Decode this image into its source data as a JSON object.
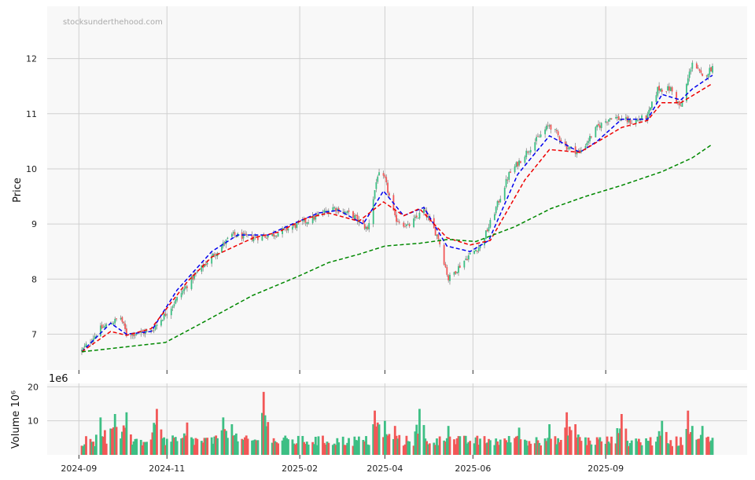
{
  "chart_data": {
    "type": "candlestick",
    "watermark": "stocksunderthehood.com",
    "colors": {
      "up": "#3dbf84",
      "down": "#f25757",
      "ma_fast": "#0000ee",
      "ma_mid": "#ee0000",
      "ma_slow": "#008800",
      "grid": "#d0d0d0",
      "panel_bg": "#f8f8f8"
    },
    "x_axis": {
      "ticks": [
        "2024-09",
        "2024-11",
        "2025-02",
        "2025-04",
        "2025-06",
        "2025-09"
      ]
    },
    "price_panel": {
      "ylabel": "Price",
      "ylim": [
        6.35,
        12.95
      ],
      "yticks": [
        "7",
        "8",
        "9",
        "10",
        "11",
        "12"
      ]
    },
    "volume_panel": {
      "ylabel": "Volume  10⁶",
      "offset_label": "1e6",
      "ylim": [
        0,
        21
      ],
      "yticks": [
        "10",
        "20"
      ]
    },
    "price_anchors": [
      [
        "2024-09-03",
        6.7
      ],
      [
        "2024-09-16",
        7.1
      ],
      [
        "2024-09-30",
        7.3
      ],
      [
        "2024-10-04",
        7.0
      ],
      [
        "2024-10-21",
        7.05
      ],
      [
        "2024-11-04",
        7.5
      ],
      [
        "2024-11-18",
        8.0
      ],
      [
        "2024-12-02",
        8.4
      ],
      [
        "2024-12-16",
        8.8
      ],
      [
        "2024-12-30",
        8.75
      ],
      [
        "2025-01-13",
        8.8
      ],
      [
        "2025-01-27",
        8.95
      ],
      [
        "2025-02-10",
        9.1
      ],
      [
        "2025-02-24",
        9.3
      ],
      [
        "2025-03-10",
        9.15
      ],
      [
        "2025-03-20",
        8.9
      ],
      [
        "2025-03-27",
        9.9
      ],
      [
        "2025-04-01",
        9.8
      ],
      [
        "2025-04-08",
        9.1
      ],
      [
        "2025-04-17",
        8.95
      ],
      [
        "2025-04-28",
        9.25
      ],
      [
        "2025-05-08",
        8.75
      ],
      [
        "2025-05-15",
        8.0
      ],
      [
        "2025-05-28",
        8.4
      ],
      [
        "2025-06-06",
        8.6
      ],
      [
        "2025-06-12",
        8.95
      ],
      [
        "2025-06-26",
        9.9
      ],
      [
        "2025-07-11",
        10.4
      ],
      [
        "2025-07-24",
        10.8
      ],
      [
        "2025-08-05",
        10.4
      ],
      [
        "2025-08-14",
        10.3
      ],
      [
        "2025-08-26",
        10.75
      ],
      [
        "2025-09-05",
        10.95
      ],
      [
        "2025-09-19",
        10.85
      ],
      [
        "2025-09-30",
        10.95
      ],
      [
        "2025-10-07",
        11.45
      ],
      [
        "2025-10-16",
        11.45
      ],
      [
        "2025-10-23",
        11.1
      ],
      [
        "2025-10-31",
        11.95
      ],
      [
        "2025-11-07",
        11.65
      ],
      [
        "2025-11-14",
        11.85
      ]
    ],
    "ma_fast": [
      [
        "2024-09-03",
        6.68
      ],
      [
        "2024-09-23",
        7.2
      ],
      [
        "2024-10-04",
        7.0
      ],
      [
        "2024-10-21",
        7.05
      ],
      [
        "2024-11-08",
        7.8
      ],
      [
        "2024-12-02",
        8.5
      ],
      [
        "2024-12-20",
        8.8
      ],
      [
        "2025-01-10",
        8.8
      ],
      [
        "2025-01-27",
        9.0
      ],
      [
        "2025-02-14",
        9.2
      ],
      [
        "2025-02-28",
        9.25
      ],
      [
        "2025-03-17",
        9.0
      ],
      [
        "2025-03-31",
        9.6
      ],
      [
        "2025-04-14",
        9.15
      ],
      [
        "2025-04-28",
        9.3
      ],
      [
        "2025-05-14",
        8.6
      ],
      [
        "2025-05-30",
        8.5
      ],
      [
        "2025-06-12",
        8.7
      ],
      [
        "2025-07-02",
        9.9
      ],
      [
        "2025-07-24",
        10.6
      ],
      [
        "2025-08-14",
        10.3
      ],
      [
        "2025-08-26",
        10.5
      ],
      [
        "2025-09-12",
        10.9
      ],
      [
        "2025-09-30",
        10.9
      ],
      [
        "2025-10-10",
        11.35
      ],
      [
        "2025-10-23",
        11.25
      ],
      [
        "2025-10-31",
        11.45
      ],
      [
        "2025-11-14",
        11.7
      ]
    ],
    "ma_mid": [
      [
        "2024-09-03",
        6.68
      ],
      [
        "2024-09-23",
        7.05
      ],
      [
        "2024-10-04",
        6.98
      ],
      [
        "2024-10-21",
        7.1
      ],
      [
        "2024-11-15",
        7.95
      ],
      [
        "2024-12-02",
        8.4
      ],
      [
        "2024-12-31",
        8.75
      ],
      [
        "2025-01-17",
        8.85
      ],
      [
        "2025-02-05",
        9.1
      ],
      [
        "2025-02-21",
        9.2
      ],
      [
        "2025-03-14",
        9.05
      ],
      [
        "2025-03-31",
        9.4
      ],
      [
        "2025-04-14",
        9.15
      ],
      [
        "2025-04-25",
        9.28
      ],
      [
        "2025-05-14",
        8.75
      ],
      [
        "2025-05-30",
        8.62
      ],
      [
        "2025-06-13",
        8.7
      ],
      [
        "2025-07-07",
        9.8
      ],
      [
        "2025-07-24",
        10.35
      ],
      [
        "2025-08-14",
        10.3
      ],
      [
        "2025-09-12",
        10.75
      ],
      [
        "2025-09-30",
        10.88
      ],
      [
        "2025-10-10",
        11.2
      ],
      [
        "2025-10-23",
        11.2
      ],
      [
        "2025-11-14",
        11.55
      ]
    ],
    "ma_slow": [
      [
        "2024-09-03",
        6.68
      ],
      [
        "2024-10-31",
        6.85
      ],
      [
        "2024-11-25",
        7.2
      ],
      [
        "2024-12-30",
        7.7
      ],
      [
        "2025-01-31",
        8.05
      ],
      [
        "2025-02-21",
        8.3
      ],
      [
        "2025-03-14",
        8.45
      ],
      [
        "2025-04-01",
        8.6
      ],
      [
        "2025-04-25",
        8.65
      ],
      [
        "2025-05-15",
        8.72
      ],
      [
        "2025-06-03",
        8.68
      ],
      [
        "2025-06-30",
        8.95
      ],
      [
        "2025-07-25",
        9.28
      ],
      [
        "2025-08-18",
        9.5
      ],
      [
        "2025-09-12",
        9.7
      ],
      [
        "2025-10-10",
        9.95
      ],
      [
        "2025-10-31",
        10.2
      ],
      [
        "2025-11-14",
        10.45
      ]
    ],
    "volume_spikes": [
      [
        "2024-09-16",
        11
      ],
      [
        "2024-09-26",
        12
      ],
      [
        "2024-10-04",
        12.5
      ],
      [
        "2024-10-25",
        13.5
      ],
      [
        "2024-11-15",
        9.5
      ],
      [
        "2024-12-10",
        11
      ],
      [
        "2024-12-16",
        9
      ],
      [
        "2025-01-07",
        18.5
      ],
      [
        "2025-03-25",
        13
      ],
      [
        "2025-03-27",
        9.5
      ],
      [
        "2025-04-01",
        10
      ],
      [
        "2025-04-08",
        8.5
      ],
      [
        "2025-04-25",
        13.5
      ],
      [
        "2025-05-15",
        8.5
      ],
      [
        "2025-07-03",
        8
      ],
      [
        "2025-07-24",
        9
      ],
      [
        "2025-08-05",
        12.5
      ],
      [
        "2025-08-11",
        9
      ],
      [
        "2025-09-12",
        12
      ],
      [
        "2025-10-10",
        10
      ],
      [
        "2025-10-28",
        13
      ],
      [
        "2025-10-31",
        8.5
      ],
      [
        "2025-11-07",
        8.5
      ]
    ]
  }
}
